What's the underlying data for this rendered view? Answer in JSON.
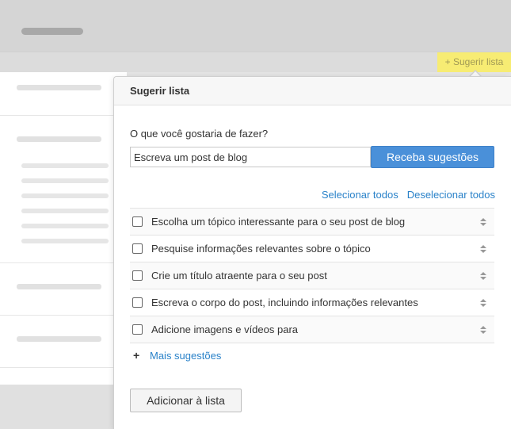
{
  "trigger": {
    "label": "+ Sugerir lista"
  },
  "popover": {
    "title": "Sugerir lista",
    "prompt_label": "O que você gostaria de fazer?",
    "prompt_value": "Escreva um post de blog",
    "get_suggestions_label": "Receba sugestões",
    "select_all": "Selecionar todos",
    "deselect_all": "Deselecionar todos",
    "items": [
      {
        "label": "Escolha um tópico interessante para o seu post de blog",
        "checked": false
      },
      {
        "label": "Pesquise informações relevantes sobre o tópico",
        "checked": false
      },
      {
        "label": "Crie um título atraente para o seu post",
        "checked": false
      },
      {
        "label": "Escreva o corpo do post, incluindo informações relevantes",
        "checked": false
      },
      {
        "label": "Adicione imagens e vídeos para",
        "checked": false
      }
    ],
    "more_suggestions": "Mais sugestões",
    "add_to_list": "Adicionar à lista"
  },
  "icons": {
    "plus": "plus-icon",
    "sort": "sort-handle-icon",
    "checkbox": "checkbox-icon"
  },
  "colors": {
    "accent": "#4a90d9",
    "link": "#2a82c9",
    "trigger_bg": "#f7ec73"
  }
}
